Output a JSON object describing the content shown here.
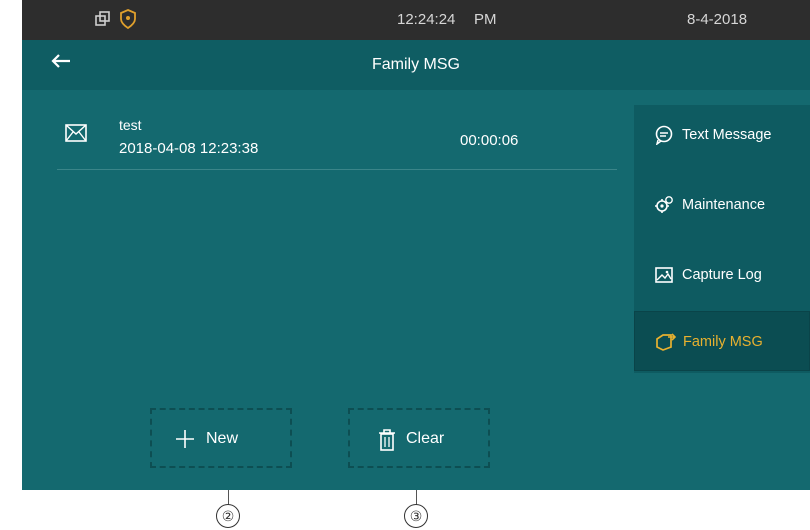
{
  "status_bar": {
    "time": "12:24:24",
    "ampm": "PM",
    "date": "8-4-2018",
    "icons": [
      "window-icon",
      "shield-icon"
    ]
  },
  "header": {
    "back_icon": "back-arrow-icon",
    "title": "Family MSG"
  },
  "messages": [
    {
      "icon": "envelope-icon",
      "title": "test",
      "datetime": "2018-04-08 12:23:38",
      "duration": "00:00:06"
    }
  ],
  "sidebar": {
    "items": [
      {
        "label": "Text Message",
        "icon": "chat-bubble-icon",
        "active": false
      },
      {
        "label": "Maintenance",
        "icon": "gears-icon",
        "active": false
      },
      {
        "label": "Capture Log",
        "icon": "image-icon",
        "active": false
      },
      {
        "label": "Family MSG",
        "icon": "family-msg-icon",
        "active": true
      }
    ]
  },
  "actions": {
    "new_label": "New",
    "new_icon": "plus-icon",
    "clear_label": "Clear",
    "clear_icon": "trash-icon"
  },
  "callouts": [
    "②",
    "③"
  ],
  "colors": {
    "background": "#14696f",
    "status_bar": "#2d2d2d",
    "active_accent": "#e8b12f",
    "shield": "#e0a02c"
  }
}
